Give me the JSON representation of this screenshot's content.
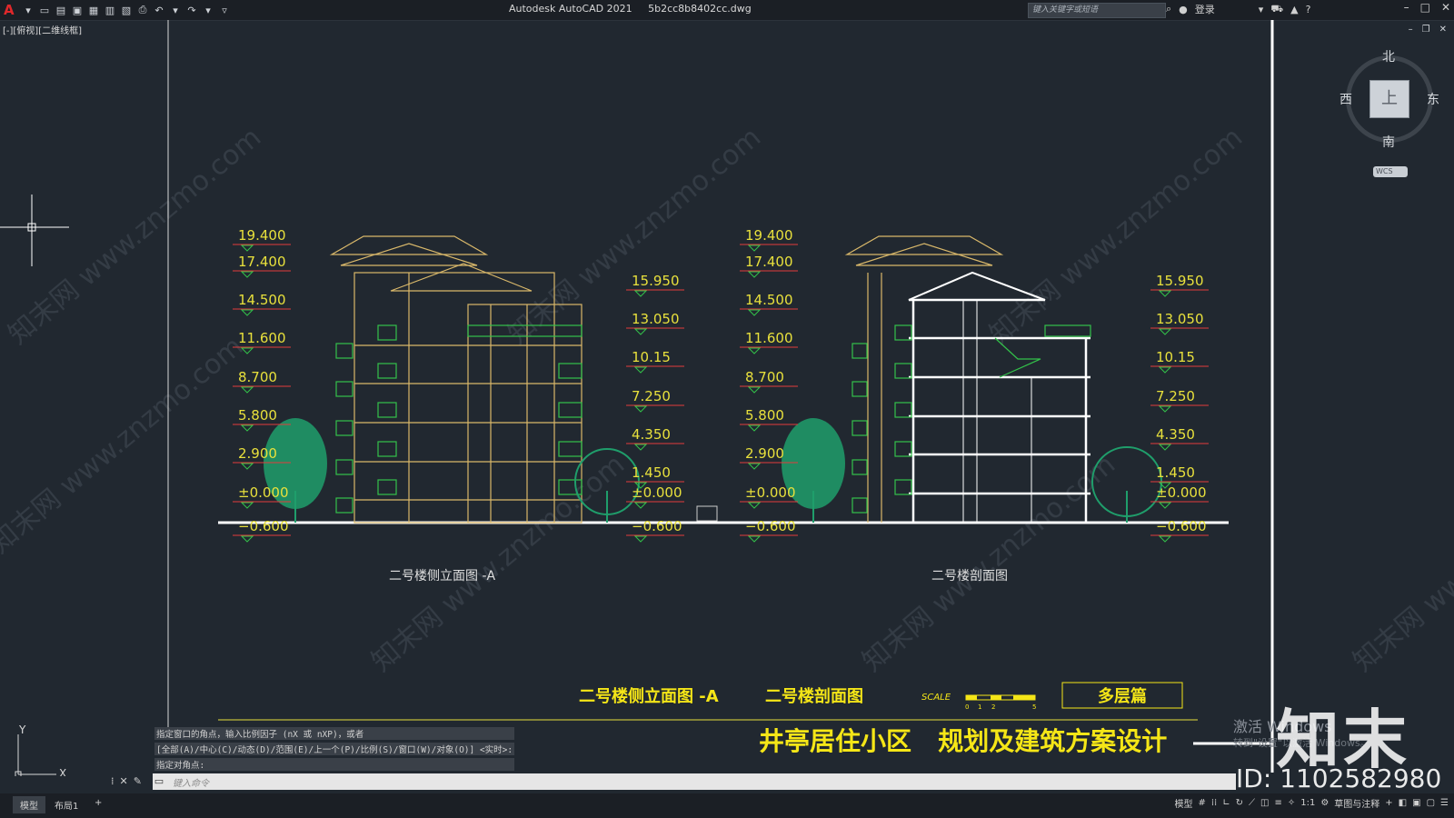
{
  "window": {
    "app_title": "Autodesk AutoCAD 2021",
    "file_name": "5b2cc8b8402cc.dwg",
    "search_placeholder": "键入关键字或短语",
    "login_label": "登录"
  },
  "viewport": {
    "label": "[-][俯视][二维线框]"
  },
  "viewcube": {
    "north": "北",
    "south": "南",
    "west": "西",
    "east": "东",
    "face": "上",
    "wcs": "WCS"
  },
  "drawing": {
    "elevation_left": [
      "19.400",
      "17.400",
      "14.500",
      "11.600",
      "8.700",
      "5.800",
      "2.900",
      "±0.000",
      "−0.600"
    ],
    "elevation_right": [
      "15.950",
      "13.050",
      "10.15",
      "7.250",
      "4.350",
      "1.450",
      "±0.000",
      "−0.600"
    ],
    "caption_a": "二号楼侧立面图 -A",
    "caption_b": "二号楼剖面图",
    "title_a": "二号楼侧立面图 -A",
    "title_b": "二号楼剖面图",
    "scale_label": "SCALE",
    "scale_ticks": [
      "0",
      "1",
      "2",
      "5"
    ],
    "stamp": "多层篇",
    "project_title": "井亭居住小区   规划及建筑方案设计",
    "watermarks": [
      "知末网 www.znzmo.com"
    ]
  },
  "command": {
    "history": [
      "指定窗口的角点，输入比例因子 (nX 或 nXP)，或者",
      "[全部(A)/中心(C)/动态(D)/范围(E)/上一个(P)/比例(S)/窗口(W)/对象(O)] <实时>:",
      "指定对角点:"
    ],
    "input_placeholder": "键入命令"
  },
  "ucs": {
    "x": "X",
    "y": "Y"
  },
  "status": {
    "tab_model": "模型",
    "tab_layout": "布局1",
    "add_tab": "+",
    "model_label": "模型",
    "scale": "1:1",
    "workspace": "草图与注释"
  },
  "overlay": {
    "activate_title": "激活 Windows",
    "activate_sub": "转到\"设置\"以激活 Windows。",
    "brand": "知末",
    "id": "ID: 1102582980"
  },
  "colors": {
    "background": "#212830",
    "building": "#d9b86a",
    "elevation_text": "#e8e03c",
    "marker": "#33c24a",
    "red_line": "#e33c3c",
    "tree": "#1f9e6b",
    "title_yellow": "#f5e617"
  }
}
